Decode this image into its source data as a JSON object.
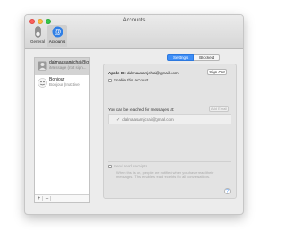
{
  "window": {
    "title": "Accounts"
  },
  "toolbar": {
    "general_label": "General",
    "accounts_label": "Accounts"
  },
  "sidebar": {
    "accounts": [
      {
        "name": "dalmaasamjchai@gmai...",
        "sub": "iMessage (not sign...",
        "selected": true
      },
      {
        "name": "Bonjour",
        "sub": "Bonjour (Inactive)",
        "selected": false
      }
    ],
    "add_label": "+",
    "remove_label": "–"
  },
  "tabs": {
    "settings": "Settings",
    "blocked": "Blocked"
  },
  "settings": {
    "apple_id_label": "Apple ID:",
    "apple_id_value": "dalmaasamjchai@gmail.com",
    "sign_out_label": "Sign Out",
    "enable_account_label": "Enable this account",
    "reach_label": "You can be reached for messages at:",
    "add_email_label": "Add Email",
    "reach_items": [
      {
        "address": "dalmaasamjchai@gmail.com",
        "checked": true
      }
    ],
    "send_receipts_label": "Send read receipts",
    "send_receipts_desc": "When this is on, people are notified when you have read their messages. This enables read receipts for all conversations.",
    "help_label": "?"
  },
  "colors": {
    "accent": "#3e8ef7",
    "selected_row": "#d3d3d3"
  }
}
